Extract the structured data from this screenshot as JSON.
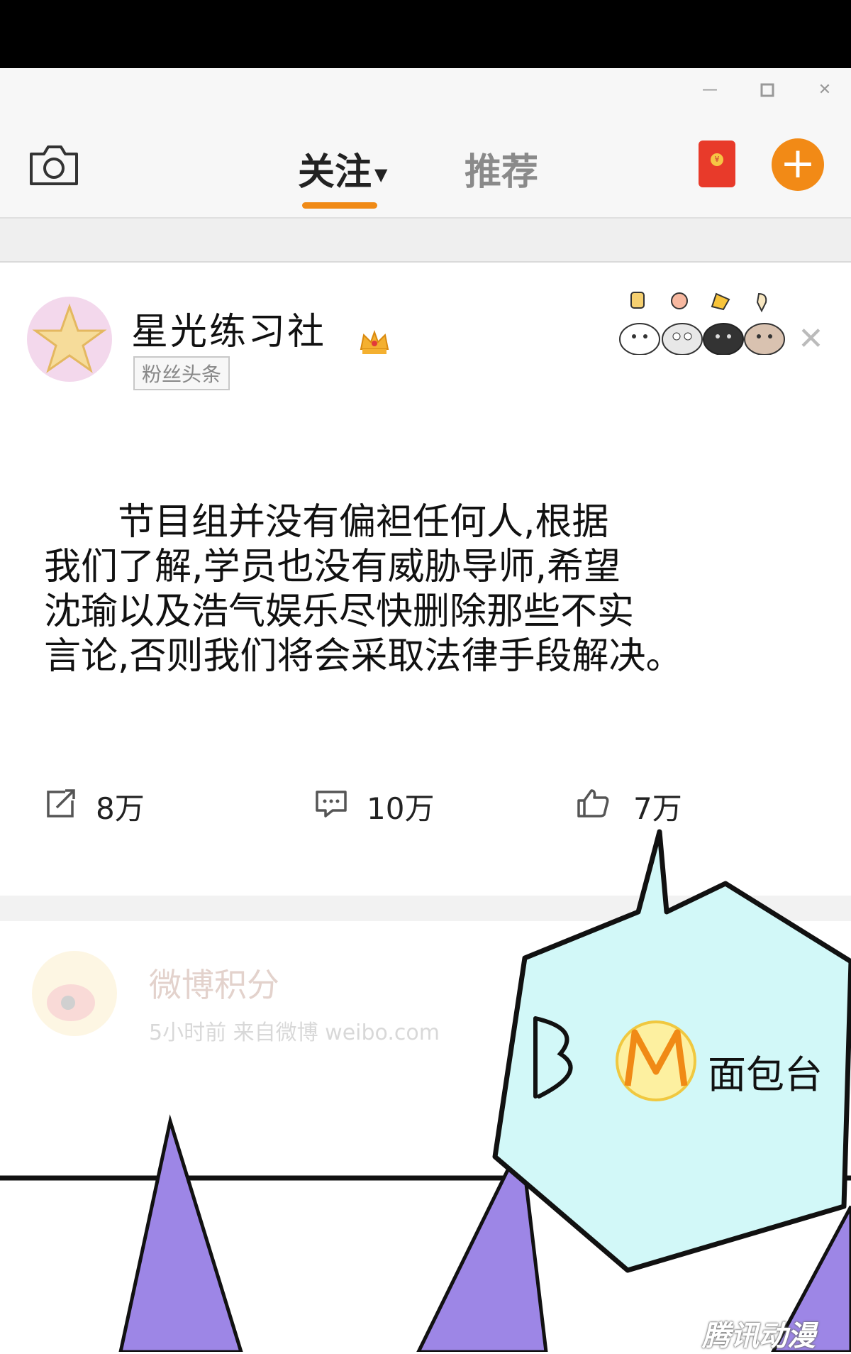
{
  "window": {
    "minimize_icon": "minimize-icon",
    "maximize_icon": "maximize-icon",
    "close_icon": "close-icon"
  },
  "nav": {
    "tab_follow": "关注",
    "tab_recommend": "推荐",
    "accent": "#f08a16"
  },
  "post": {
    "author": "星光练习社",
    "badge": "粉丝头条",
    "lines": [
      "　　节目组并没有偏袒任何人,根据",
      "我们了解,学员也没有威胁导师,希望",
      "沈瑜以及浩气娱乐尽快删除那些不实",
      "言论,否则我们将会采取法律手段解决。"
    ],
    "repost_count": "8万",
    "comment_count": "10万",
    "like_count": "7万"
  },
  "next_post": {
    "author": "微博积分",
    "meta": "5小时前 来自微博 weibo.com"
  },
  "comic": {
    "bubble_letter": "B",
    "bubble_logo": "M",
    "bubble_text": "面包台",
    "watermark": "腾讯动漫",
    "bubble_color": "#d2f8f8",
    "spike_color": "#9d86e6"
  }
}
